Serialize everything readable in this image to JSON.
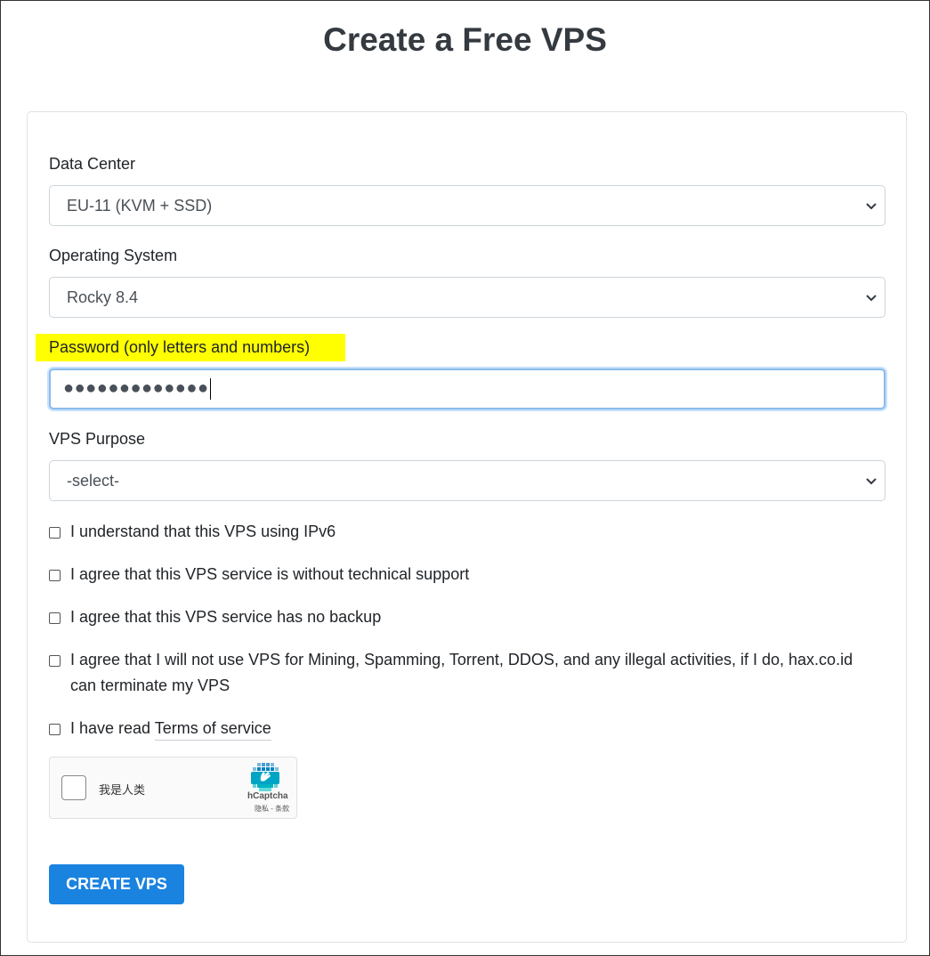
{
  "page": {
    "title": "Create a Free VPS"
  },
  "form": {
    "data_center": {
      "label": "Data Center",
      "selected": "EU-11 (KVM + SSD)"
    },
    "operating_system": {
      "label": "Operating System",
      "selected": "Rocky 8.4"
    },
    "password": {
      "label": "Password (only letters and numbers)",
      "masked_value": "●●●●●●●●●●●●●",
      "highlight_color": "#ffff00"
    },
    "vps_purpose": {
      "label": "VPS Purpose",
      "selected": "-select-"
    },
    "agreements": [
      {
        "text": "I understand that this VPS using IPv6",
        "checked": false
      },
      {
        "text": "I agree that this VPS service is without technical support",
        "checked": false
      },
      {
        "text": "I agree that this VPS service has no backup",
        "checked": false
      },
      {
        "text": "I agree that I will not use VPS for Mining, Spamming, Torrent, DDOS, and any illegal activities, if I do, hax.co.id can terminate my VPS",
        "checked": false
      }
    ],
    "terms": {
      "prefix": "I have read",
      "link_text": "Terms of service",
      "checked": false
    },
    "captcha": {
      "label": "我是人类",
      "brand": "hCaptcha",
      "links": "隐私 - 条款",
      "logo_icon": "hcaptcha-logo-icon",
      "checked": false
    },
    "submit": {
      "label": "CREATE VPS",
      "color": "#1a83e0"
    }
  }
}
